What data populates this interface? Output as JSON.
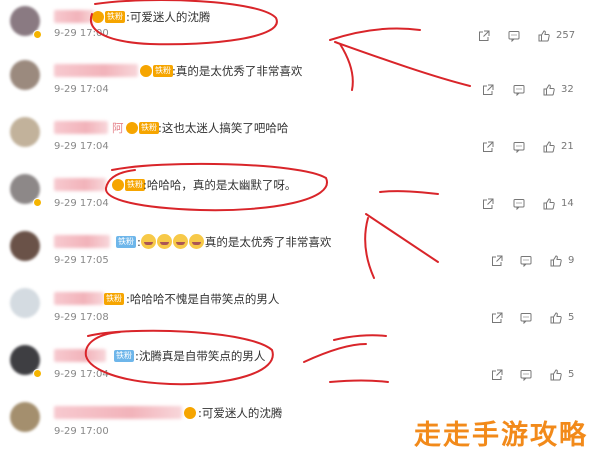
{
  "comments": [
    {
      "text": "可爱迷人的沈腾",
      "time": "9-29 17:00",
      "likes": "257",
      "badge": "铁粉",
      "badge_color": "orange",
      "avatar_color": "#8a7a82"
    },
    {
      "text": "真的是太优秀了非常喜欢",
      "time": "9-29 17:04",
      "likes": "32",
      "badge": "铁粉",
      "badge_color": "orange",
      "avatar_color": "#9b8a7e"
    },
    {
      "text": "这也太迷人搞笑了吧哈哈",
      "time": "9-29 17:04",
      "likes": "21",
      "badge": "铁粉",
      "badge_color": "orange",
      "avatar_color": "#c2b29b",
      "name_suffix": "阿"
    },
    {
      "text": "哈哈哈，真的是太幽默了呀。",
      "time": "9-29 17:04",
      "likes": "14",
      "badge": "铁粉",
      "badge_color": "orange",
      "avatar_color": "#8d8888"
    },
    {
      "text": "真的是太优秀了非常喜欢",
      "time": "9-29 17:05",
      "likes": "9",
      "badge": "铁粉",
      "badge_color": "blue",
      "avatar_color": "#6a5248",
      "emoji_count": 4
    },
    {
      "text": "哈哈哈不愧是自带笑点的男人",
      "time": "9-29 17:08",
      "likes": "5",
      "badge": "铁粉",
      "badge_color": "orange",
      "avatar_color": "#d4dbe1"
    },
    {
      "text": "沈腾真是自带笑点的男人",
      "time": "9-29 17:04",
      "likes": "5",
      "badge": "铁粉",
      "badge_color": "blue",
      "avatar_color": "#3e3e42"
    },
    {
      "text": "可爱迷人的沈腾",
      "time": "9-29 17:00",
      "likes": "",
      "badge": "",
      "badge_color": "orange",
      "avatar_color": "#a48f6e"
    }
  ],
  "watermark": "走走手游攻略",
  "icons": {
    "share": "share-icon",
    "comment": "comment-icon",
    "like": "thumbs-up-icon"
  },
  "colors": {
    "annotation_red": "#d9252a",
    "watermark": "#f28a1a"
  }
}
